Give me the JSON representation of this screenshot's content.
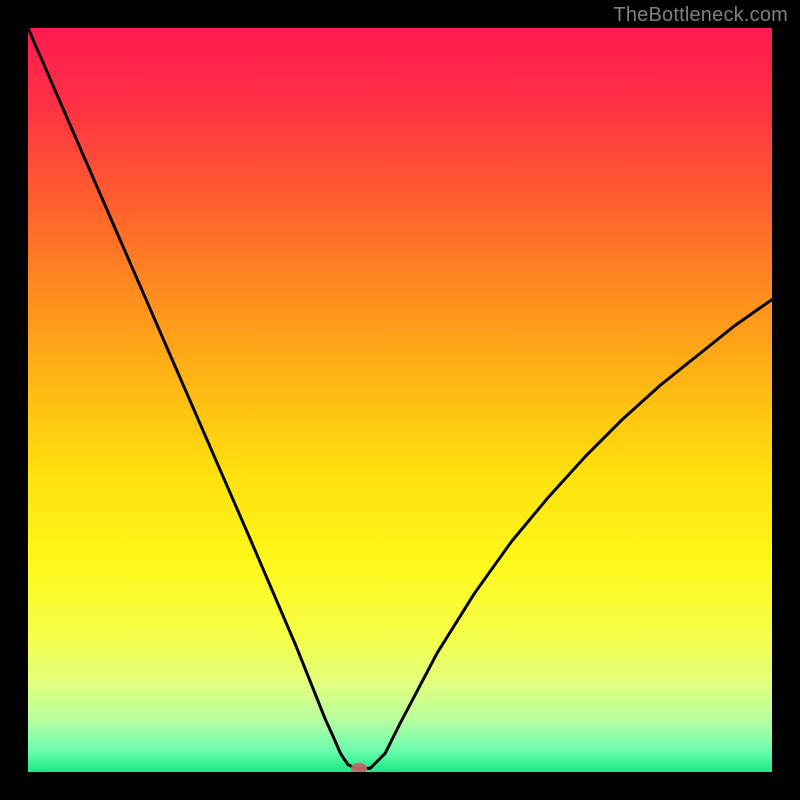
{
  "watermark": "TheBottleneck.com",
  "chart_data": {
    "type": "line",
    "title": "",
    "xlabel": "",
    "ylabel": "",
    "xlim": [
      0,
      100
    ],
    "ylim": [
      0,
      100
    ],
    "grid": false,
    "series": [
      {
        "name": "curve",
        "x": [
          0,
          5,
          10,
          15,
          20,
          25,
          30,
          33,
          36,
          38,
          40,
          41,
          42,
          43,
          44,
          45,
          46,
          48,
          50,
          55,
          60,
          65,
          70,
          75,
          80,
          85,
          90,
          95,
          100
        ],
        "y": [
          100,
          88.5,
          77,
          65.5,
          54,
          42.5,
          31,
          24,
          17,
          12,
          7,
          4.8,
          2.5,
          1,
          0.5,
          0.5,
          0.5,
          2.5,
          6.5,
          16,
          24,
          31,
          37,
          42.5,
          47.5,
          52,
          56,
          60,
          63.5
        ]
      }
    ],
    "marker": {
      "x": 44.5,
      "y": 0.5,
      "color": "#c9666b"
    },
    "background_gradient": {
      "stops": [
        {
          "pos": 0.0,
          "color": "#ff1a50"
        },
        {
          "pos": 0.1,
          "color": "#ff3044"
        },
        {
          "pos": 0.22,
          "color": "#ff5a2f"
        },
        {
          "pos": 0.35,
          "color": "#ff8a1f"
        },
        {
          "pos": 0.48,
          "color": "#ffb813"
        },
        {
          "pos": 0.6,
          "color": "#ffe10e"
        },
        {
          "pos": 0.72,
          "color": "#fff81a"
        },
        {
          "pos": 0.82,
          "color": "#f4ff4a"
        },
        {
          "pos": 0.88,
          "color": "#e2ff7d"
        },
        {
          "pos": 0.93,
          "color": "#b7ff9f"
        },
        {
          "pos": 0.97,
          "color": "#6dfdb0"
        },
        {
          "pos": 1.0,
          "color": "#19e884"
        }
      ]
    }
  }
}
